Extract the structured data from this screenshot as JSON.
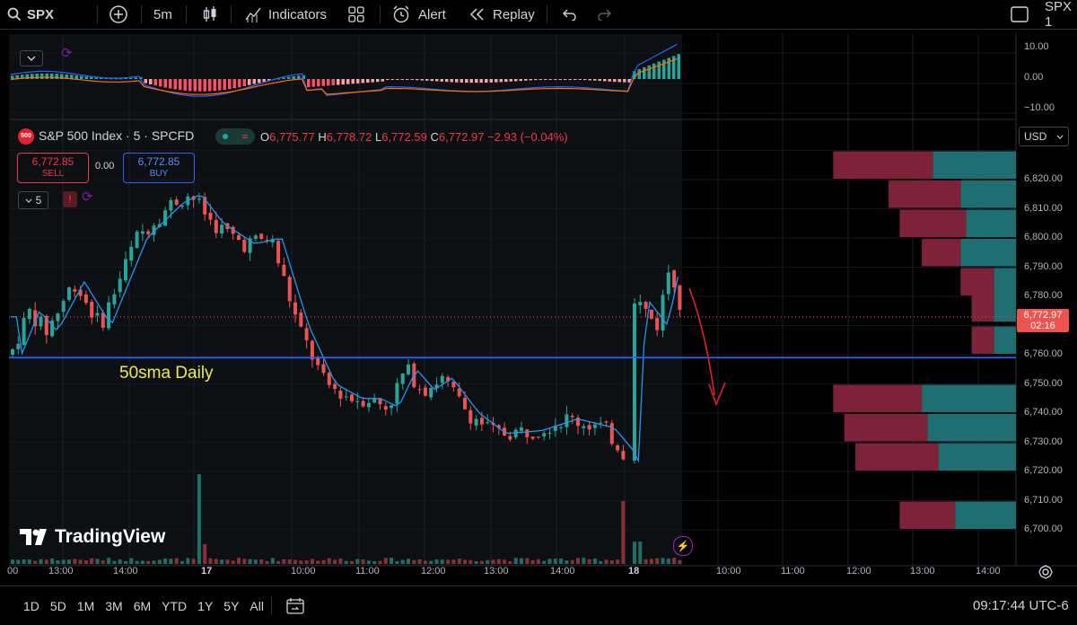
{
  "toolbar": {
    "symbol": "SPX",
    "interval": "5m",
    "indicators": "Indicators",
    "alert": "Alert",
    "replay": "Replay",
    "right_symbol": "SPX 1"
  },
  "legend": {
    "title": "S&P 500 Index · 5 · SPCFD",
    "badge": "500",
    "open_label": "O",
    "open": "6,775.77",
    "high_label": "H",
    "high": "6,778.72",
    "low_label": "L",
    "low": "6,772.59",
    "close_label": "C",
    "close": "6,772.97",
    "change": "−2.93 (−0.04%)",
    "sell_price": "6,772.85",
    "sell_label": "SELL",
    "spread": "0.00",
    "buy_price": "6,772.85",
    "buy_label": "BUY",
    "indicator_count": "5"
  },
  "macd_scale": [
    "10.00",
    "0.00",
    "−10.00"
  ],
  "currency": "USD",
  "price_scale": [
    "6,820.00",
    "6,810.00",
    "6,800.00",
    "6,790.00",
    "6,780.00",
    "6,760.00",
    "6,750.00",
    "6,740.00",
    "6,730.00",
    "6,720.00",
    "6,710.00",
    "6,700.00"
  ],
  "last_price": {
    "value": "6,772.97",
    "countdown": "02:16"
  },
  "annotation": "50sma Daily",
  "watermark": "TradingView",
  "time_scale": [
    "00",
    "13:00",
    "14:00",
    "17",
    "10:00",
    "11:00",
    "12:00",
    "13:00",
    "14:00",
    "18",
    "10:00",
    "11:00",
    "12:00",
    "13:00",
    "14:00"
  ],
  "ranges": [
    "1D",
    "5D",
    "1M",
    "3M",
    "6M",
    "YTD",
    "1Y",
    "5Y",
    "All"
  ],
  "clock": "09:17:44 UTC-6",
  "colors": {
    "up": "#26a69a",
    "down": "#ef5350",
    "sma_line": "#2962ff",
    "profile_red": "#7e2239",
    "profile_teal": "#1e6e72"
  },
  "chart_data": {
    "type": "candlestick",
    "price_range": [
      6691,
      6833
    ],
    "sma_daily_level": 6759,
    "last_close": 6772.97,
    "volume_profile": [
      {
        "price": 6825,
        "sell": 0.18,
        "buy": 0.15
      },
      {
        "price": 6815,
        "sell": 0.13,
        "buy": 0.1
      },
      {
        "price": 6805,
        "sell": 0.12,
        "buy": 0.09
      },
      {
        "price": 6795,
        "sell": 0.07,
        "buy": 0.1
      },
      {
        "price": 6785,
        "sell": 0.06,
        "buy": 0.04
      },
      {
        "price": 6776,
        "sell": 0.04,
        "buy": 0.04
      },
      {
        "price": 6765,
        "sell": 0.04,
        "buy": 0.04
      },
      {
        "price": 6745,
        "sell": 0.16,
        "buy": 0.17
      },
      {
        "price": 6735,
        "sell": 0.15,
        "buy": 0.16
      },
      {
        "price": 6725,
        "sell": 0.15,
        "buy": 0.14
      },
      {
        "price": 6705,
        "sell": 0.1,
        "buy": 0.11
      }
    ]
  }
}
